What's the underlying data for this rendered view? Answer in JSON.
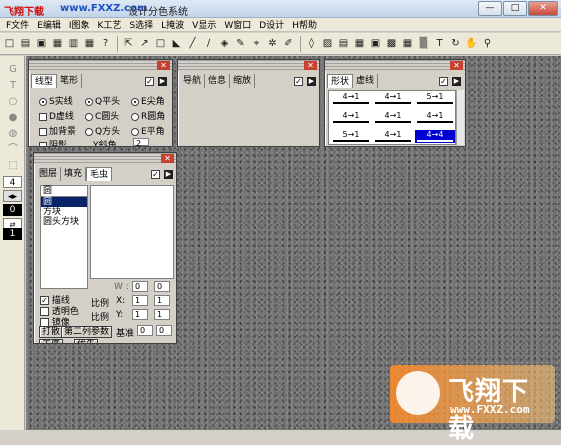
{
  "titlebar": {
    "watermark_site": "飞翔下载",
    "watermark_url": "www.FXXZ.com",
    "title": "设计分色系统",
    "buttons": [
      "—",
      "□",
      "✕"
    ]
  },
  "menu": [
    "F文件",
    "E编辑",
    "I图象",
    "K工艺",
    "S选择",
    "L掩波",
    "V显示",
    "W窗口",
    "D设计",
    "H帮助"
  ],
  "toolbar": {
    "icons": [
      "new-icon",
      "open-icon",
      "save-icon",
      "print-icon",
      "copy-icon",
      "paste-icon",
      "help-icon",
      "sep",
      "pointer-icon",
      "bezier-icon",
      "rect-icon",
      "blue-shape-icon",
      "line-icon",
      "pen-icon",
      "fill-icon",
      "dropper-icon",
      "crop-icon",
      "spray-icon",
      "brush-icon",
      "sep",
      "drop-icon",
      "color-icon",
      "layer-icon",
      "grid-icon",
      "frame-icon",
      "texture-icon",
      "pattern-icon",
      "mesh-icon",
      "text-icon",
      "rotate-icon",
      "hand-icon",
      "zoom-icon"
    ],
    "glyphs": [
      "□",
      "▤",
      "▣",
      "▦",
      "▥",
      "▦",
      "?",
      "|",
      "⇱",
      "↗",
      "□",
      "◣",
      "╱",
      "∕",
      "◈",
      "✎",
      "⌖",
      "✲",
      "✐",
      "|",
      "◊",
      "▨",
      "▤",
      "▦",
      "▣",
      "▩",
      "▦",
      "▒",
      "T",
      "↻",
      "✋",
      "⚲"
    ]
  },
  "lefttool": {
    "icons": [
      "g-tool-icon",
      "t-tool-icon",
      "oval-tool-icon",
      "blob-tool-icon",
      "drop-tool-icon",
      "curve-tool-icon",
      "select-tool-icon"
    ],
    "glyphs": [
      "G",
      "T",
      "○",
      "●",
      "◍",
      "⌒",
      "⬚"
    ],
    "value1": "4",
    "value2": "0",
    "value3": "1"
  },
  "panel_line": {
    "tabs": [
      "线型",
      "笔形"
    ],
    "options": [
      {
        "label": "S实线",
        "type": "radio",
        "checked": true
      },
      {
        "label": "Q平头",
        "type": "radio",
        "checked": true
      },
      {
        "label": "E尖角",
        "type": "radio",
        "checked": true
      },
      {
        "label": "D虚线",
        "type": "check",
        "checked": false
      },
      {
        "label": "C圆头",
        "type": "radio",
        "checked": false
      },
      {
        "label": "R圆角",
        "type": "radio",
        "checked": false
      },
      {
        "label": "加背景",
        "type": "check",
        "checked": false
      },
      {
        "label": "Q方头",
        "type": "radio",
        "checked": false
      },
      {
        "label": "E平角",
        "type": "radio",
        "checked": false
      },
      {
        "label": "阴影",
        "type": "check",
        "checked": false
      },
      {
        "label": "Y斜角",
        "type": "text",
        "checked": false
      }
    ],
    "value_box": "2"
  },
  "panel_nav": {
    "tabs": [
      "导航",
      "信息",
      "缩放"
    ]
  },
  "panel_shape": {
    "tabs": [
      "形状",
      "虚线"
    ],
    "cells": [
      "4→1",
      "4→1",
      "5→1",
      "4→1",
      "4→1",
      "4→1",
      "5→1",
      "4→1",
      "4→4"
    ],
    "selected_index": 8
  },
  "panel_brush": {
    "tabs": [
      "图层",
      "填充",
      "毛虫"
    ],
    "list_header": "圆",
    "list_items": [
      "圆",
      "方块",
      "圆头方块"
    ],
    "selected_item": 0,
    "wh_label": "W : H",
    "wh_values": [
      "0",
      "0"
    ],
    "ratio_label": "比例",
    "ratio_rows": [
      {
        "axis": "X:",
        "v1": "1",
        "v2": "1"
      },
      {
        "axis": "Y:",
        "v1": "1",
        "v2": "1"
      }
    ],
    "base_label": "基准",
    "base_values": [
      "0",
      "0"
    ],
    "checks": [
      {
        "label": "描线",
        "checked": true
      },
      {
        "label": "透明色",
        "checked": false
      },
      {
        "label": "镜像",
        "checked": false
      }
    ],
    "btn_print": "打散",
    "btn_param": "第二列参数",
    "bottom_left": "工序",
    "bottom_mid": "优先"
  },
  "logo": {
    "main": "飞翔下载",
    "url": "www.FXXZ.com"
  }
}
